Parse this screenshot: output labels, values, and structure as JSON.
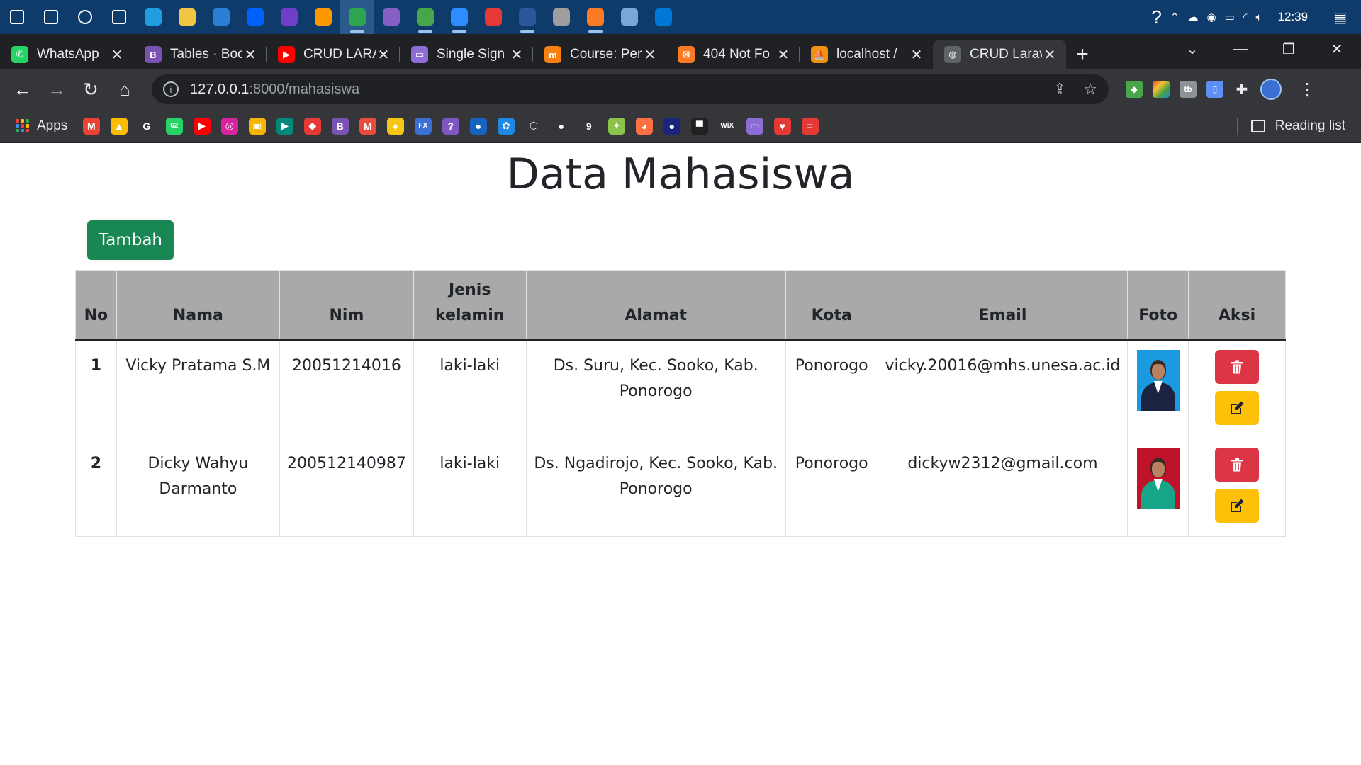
{
  "taskbar": {
    "clock": "12:39",
    "icons": [
      {
        "name": "windows-start-icon",
        "color": "#ffffff"
      },
      {
        "name": "search-icon",
        "color": "#ffffff"
      },
      {
        "name": "cortana-icon",
        "color": "#ffffff"
      },
      {
        "name": "task-view-icon",
        "color": "#ffffff"
      },
      {
        "name": "edge-icon",
        "color": "#1f9de0"
      },
      {
        "name": "file-explorer-icon",
        "color": "#f4c542"
      },
      {
        "name": "mail-icon",
        "color": "#2a7fd4"
      },
      {
        "name": "dropbox-icon",
        "color": "#0061fe"
      },
      {
        "name": "github-desktop-icon",
        "color": "#6e40c9"
      },
      {
        "name": "sublime-text-icon",
        "color": "#ff9800"
      },
      {
        "name": "chrome-icon",
        "color": "#2fa44f"
      },
      {
        "name": "visual-studio-icon",
        "color": "#865fc5"
      },
      {
        "name": "app-icon",
        "color": "#48a54a"
      },
      {
        "name": "zoom-icon",
        "color": "#2d8cff"
      },
      {
        "name": "screen-recorder-icon",
        "color": "#e53935"
      },
      {
        "name": "word-icon",
        "color": "#2b579a"
      },
      {
        "name": "app2-icon",
        "color": "#9e9e9e"
      },
      {
        "name": "xampp-icon",
        "color": "#fb7a24"
      },
      {
        "name": "app3-icon",
        "color": "#7aa7d6"
      },
      {
        "name": "vscode-icon",
        "color": "#0078d7"
      }
    ]
  },
  "browser": {
    "tabs": [
      {
        "title": "WhatsApp",
        "favicon": "whatsapp-icon",
        "color": "#25d366",
        "glyph": "✆"
      },
      {
        "title": "Tables · Boo",
        "favicon": "bootstrap-icon",
        "color": "#7952b3",
        "glyph": "B"
      },
      {
        "title": "CRUD LARA",
        "favicon": "youtube-icon",
        "color": "#ff0000",
        "glyph": "▶"
      },
      {
        "title": "Single Sign",
        "favicon": "app-icon",
        "color": "#8e6cd6",
        "glyph": "▭"
      },
      {
        "title": "Course: Pen",
        "favicon": "moodle-icon",
        "color": "#f98012",
        "glyph": "m"
      },
      {
        "title": "404 Not Fo",
        "favicon": "xampp-icon",
        "color": "#fb7a24",
        "glyph": "⊠"
      },
      {
        "title": "localhost /",
        "favicon": "phpmyadmin-icon",
        "color": "#f29111",
        "glyph": "⛵"
      },
      {
        "title": "CRUD Larav",
        "favicon": "globe-icon",
        "color": "#5f6368",
        "glyph": "◍",
        "active": true
      }
    ],
    "new_tab": "+",
    "url_host": "127.0.0.1",
    "url_path": ":8000/mahasiswa",
    "bookmarks_apps": "Apps",
    "reading_list": "Reading list",
    "bookmark_icons": [
      {
        "name": "gmail-icon",
        "color": "#ea4335",
        "glyph": "M"
      },
      {
        "name": "google-drive-icon",
        "color": "#fbbc04",
        "glyph": "▲"
      },
      {
        "name": "google-icon",
        "color": "#ffffff",
        "glyph": "G"
      },
      {
        "name": "whatsapp-icon",
        "color": "#25d366",
        "glyph": "62"
      },
      {
        "name": "youtube-icon",
        "color": "#ff0000",
        "glyph": "▶"
      },
      {
        "name": "instagram-icon",
        "color": "#d6249f",
        "glyph": "◎"
      },
      {
        "name": "classroom-icon",
        "color": "#f4b400",
        "glyph": "▣"
      },
      {
        "name": "meet-icon",
        "color": "#00897b",
        "glyph": "▶"
      },
      {
        "name": "app-icon",
        "color": "#e53935",
        "glyph": "◆"
      },
      {
        "name": "bootstrap-icon",
        "color": "#7952b3",
        "glyph": "B"
      },
      {
        "name": "mendeley-icon",
        "color": "#e74c3c",
        "glyph": "M"
      },
      {
        "name": "app2-icon",
        "color": "#f5c518",
        "glyph": "♦"
      },
      {
        "name": "fx-icon",
        "color": "#3b6fd1",
        "glyph": "FX"
      },
      {
        "name": "app3-icon",
        "color": "#7e57c2",
        "glyph": "?"
      },
      {
        "name": "edge-icon",
        "color": "#1565c0",
        "glyph": "●"
      },
      {
        "name": "app4-icon",
        "color": "#1e88e5",
        "glyph": "✿"
      },
      {
        "name": "codepen-icon",
        "color": "#ffffff",
        "glyph": "⬡"
      },
      {
        "name": "github-icon",
        "color": "#ffffff",
        "glyph": "●"
      },
      {
        "name": "app5-icon",
        "color": "#ffffff",
        "glyph": "9"
      },
      {
        "name": "app6-icon",
        "color": "#8bc34a",
        "glyph": "✦"
      },
      {
        "name": "app7-icon",
        "color": "#ff7043",
        "glyph": "◕"
      },
      {
        "name": "app8-icon",
        "color": "#1a237e",
        "glyph": "●"
      },
      {
        "name": "app9-icon",
        "color": "#212121",
        "glyph": "▀"
      },
      {
        "name": "wix-icon",
        "color": "#ffffff",
        "glyph": "WiX"
      },
      {
        "name": "app10-icon",
        "color": "#8e6cd6",
        "glyph": "▭"
      },
      {
        "name": "app11-icon",
        "color": "#e53935",
        "glyph": "♥"
      },
      {
        "name": "app12-icon",
        "color": "#e53935",
        "glyph": "="
      }
    ]
  },
  "page": {
    "title": "Data Mahasiswa",
    "add_button": "Tambah",
    "columns": {
      "no": "No",
      "nama": "Nama",
      "nim": "Nim",
      "jenis_kelamin": "Jenis kelamin",
      "alamat": "Alamat",
      "kota": "Kota",
      "email": "Email",
      "foto": "Foto",
      "aksi": "Aksi"
    },
    "rows": [
      {
        "no": "1",
        "nama": "Vicky Pratama S.M",
        "nim": "20051214016",
        "jenis_kelamin": "laki-laki",
        "alamat": "Ds. Suru, Kec. Sooko, Kab. Ponorogo",
        "kota": "Ponorogo",
        "email": "vicky.20016@mhs.unesa.ac.id",
        "photo_bg": "#1a9be0",
        "photo_outfit": "#1c2340"
      },
      {
        "no": "2",
        "nama": "Dicky Wahyu Darmanto",
        "nim": "200512140987",
        "jenis_kelamin": "laki-laki",
        "alamat": "Ds. Ngadirojo, Kec. Sooko, Kab. Ponorogo",
        "kota": "Ponorogo",
        "email": "dickyw2312@gmail.com",
        "photo_bg": "#c0132a",
        "photo_outfit": "#17a589"
      }
    ]
  },
  "colors": {
    "btn_success": "#198754",
    "btn_danger": "#dc3545",
    "btn_warning": "#ffc107",
    "table_header": "#a9a9a9"
  }
}
